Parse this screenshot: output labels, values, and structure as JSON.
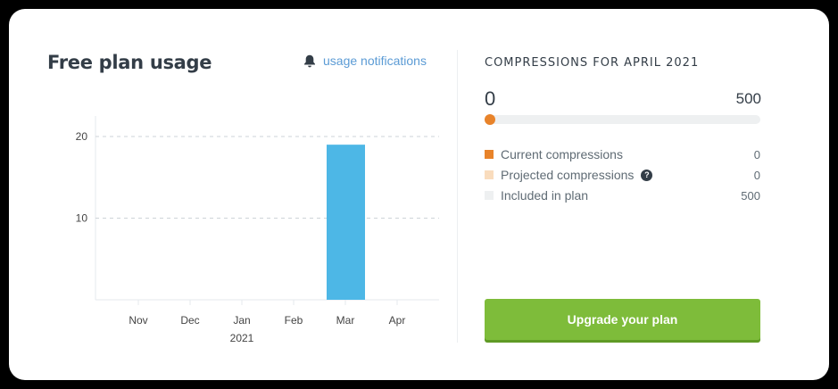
{
  "usage": {
    "title": "Free plan usage",
    "notifications_label": "usage notifications",
    "icons": {
      "notifications": "bell-icon",
      "help": "question-circle-icon"
    }
  },
  "chart_data": {
    "type": "bar",
    "categories": [
      "Nov",
      "Dec",
      "Jan",
      "Feb",
      "Mar",
      "Apr"
    ],
    "year_label": "2021",
    "values": [
      0,
      0,
      0,
      0,
      19,
      0
    ],
    "yticks": [
      10,
      20
    ],
    "ylim": [
      0,
      20
    ],
    "grid": true,
    "bar_color": "#4db7e6"
  },
  "compressions": {
    "heading": "COMPRESSIONS FOR APRIL 2021",
    "min_label": "0",
    "max_label": "500",
    "progress_fraction": 0,
    "legend": [
      {
        "label": "Current compressions",
        "value": "0",
        "color": "#e8832a",
        "help": false
      },
      {
        "label": "Projected compressions",
        "value": "0",
        "color": "#f9dcbd",
        "help": true
      },
      {
        "label": "Included in plan",
        "value": "500",
        "color": "#eef0f1",
        "help": false
      }
    ],
    "upgrade_label": "Upgrade your plan"
  }
}
